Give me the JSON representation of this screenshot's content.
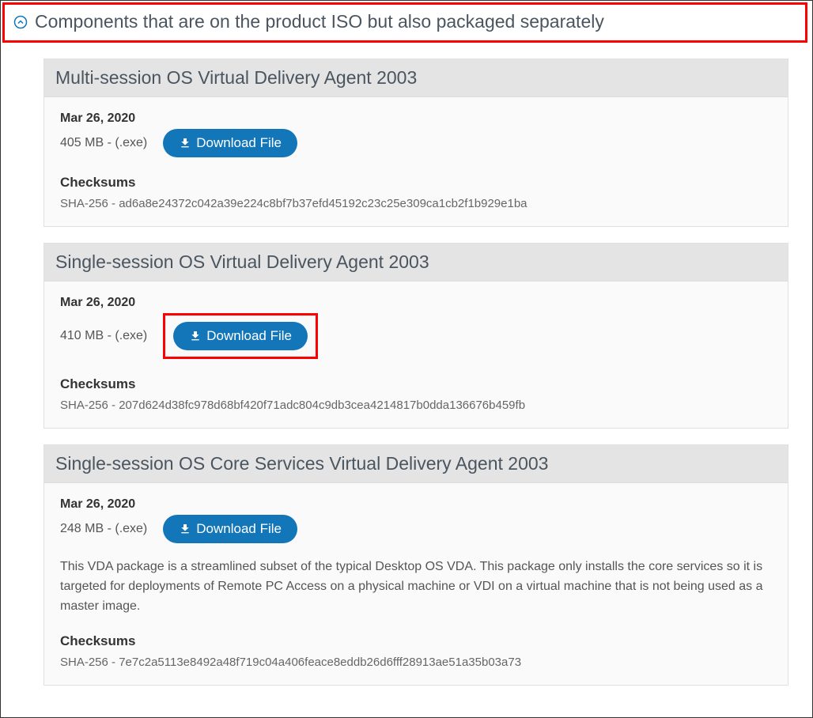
{
  "section": {
    "title": "Components that are on the product ISO but also packaged separately"
  },
  "cards": [
    {
      "title": "Multi-session OS Virtual Delivery Agent 2003",
      "date": "Mar 26, 2020",
      "size": "405 MB - (.exe)",
      "button_label": "Download File",
      "highlighted": false,
      "description": "",
      "checksums_heading": "Checksums",
      "checksum": "SHA-256 - ad6a8e24372c042a39e224c8bf7b37efd45192c23c25e309ca1cb2f1b929e1ba"
    },
    {
      "title": "Single-session OS Virtual Delivery Agent 2003",
      "date": "Mar 26, 2020",
      "size": "410 MB - (.exe)",
      "button_label": "Download File",
      "highlighted": true,
      "description": "",
      "checksums_heading": "Checksums",
      "checksum": "SHA-256 - 207d624d38fc978d68bf420f71adc804c9db3cea4214817b0dda136676b459fb"
    },
    {
      "title": "Single-session OS Core Services Virtual Delivery Agent 2003",
      "date": "Mar 26, 2020",
      "size": "248 MB - (.exe)",
      "button_label": "Download File",
      "highlighted": false,
      "description": "This VDA package is a streamlined subset of the typical Desktop OS VDA. This package only installs the core services so it is targeted for deployments of Remote PC Access on a physical machine or VDI on a virtual machine that is not being used as a master image.",
      "checksums_heading": "Checksums",
      "checksum": "SHA-256 - 7e7c2a5113e8492a48f719c04a406feace8eddb26d6fff28913ae51a35b03a73"
    }
  ]
}
